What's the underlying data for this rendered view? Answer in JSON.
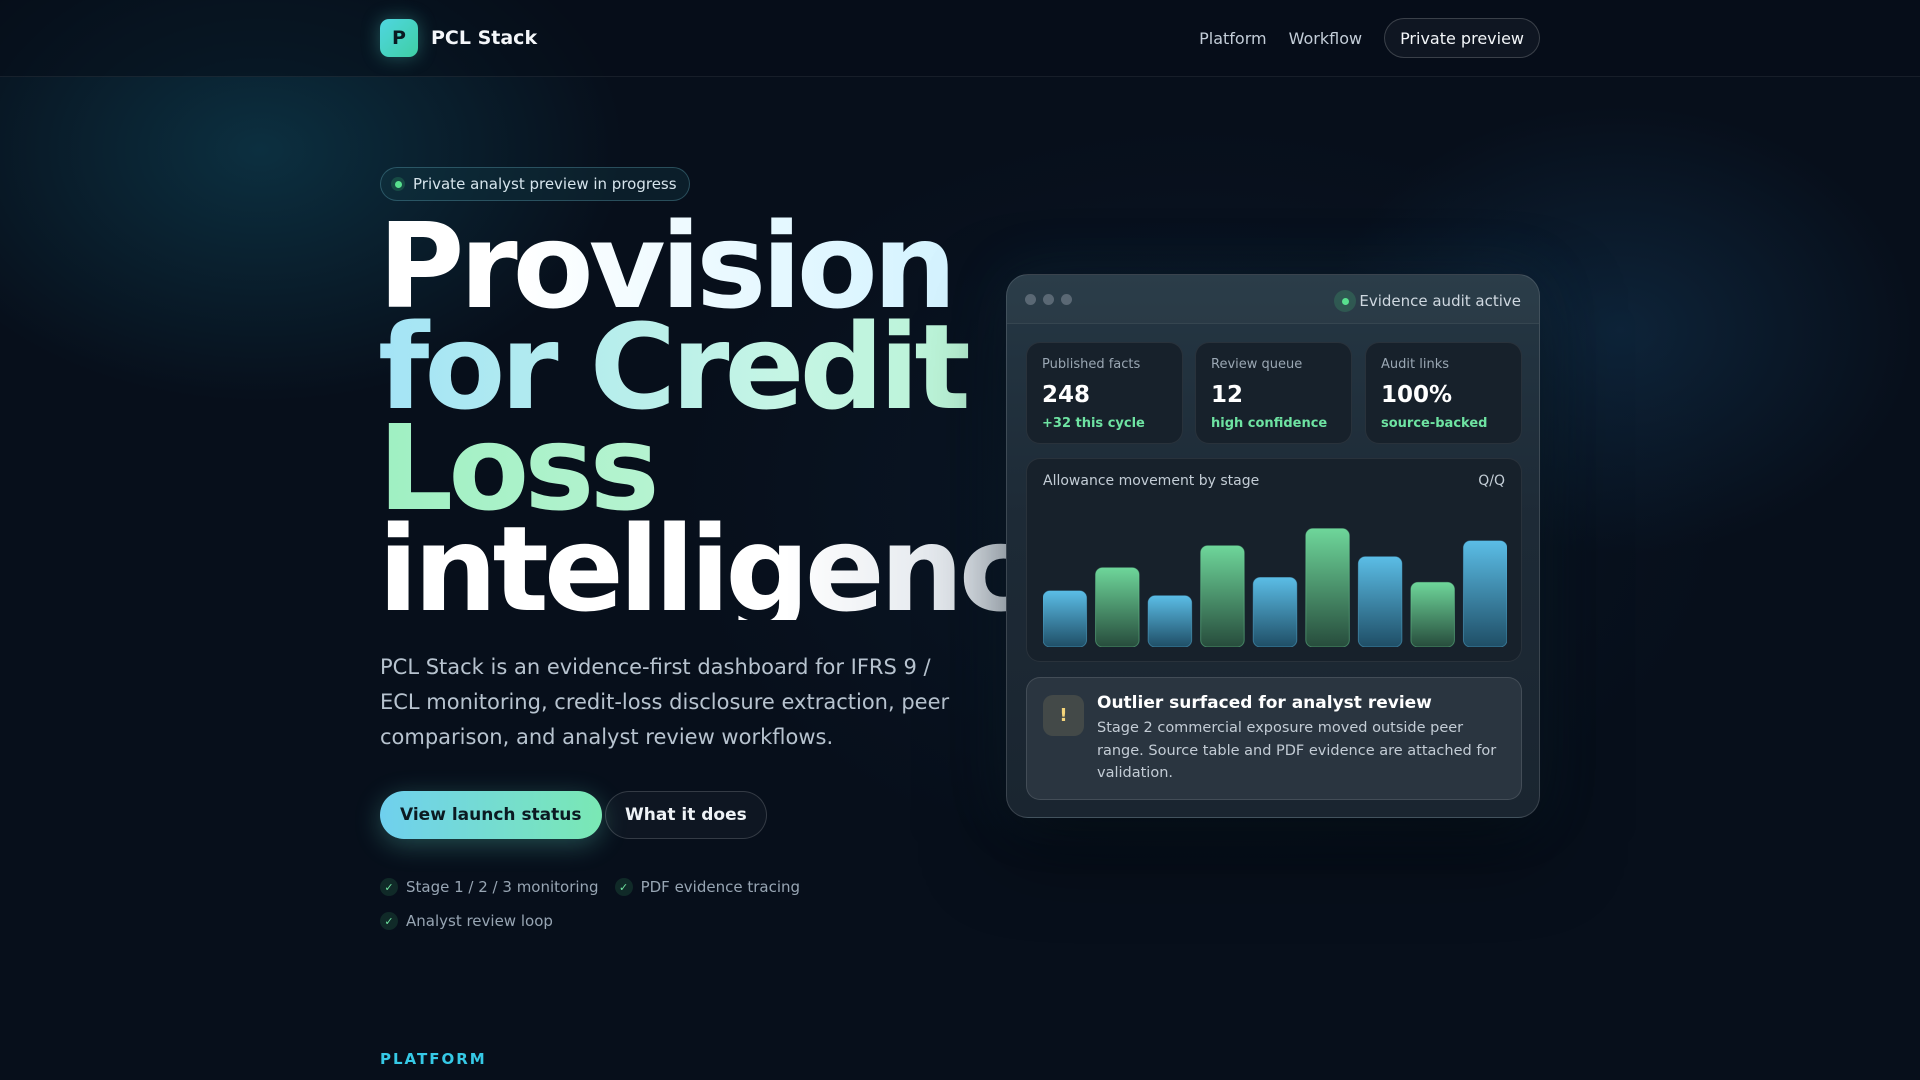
{
  "header": {
    "logo_letter": "P",
    "brand": "PCL Stack",
    "nav": [
      "Platform",
      "Workflow"
    ],
    "cta": "Private preview"
  },
  "hero": {
    "badge": "Private analyst preview in progress",
    "headline": [
      "Provision",
      "for Credit",
      "Loss",
      "intelligence."
    ],
    "lead": "PCL Stack is an evidence-first dashboard for IFRS 9 / ECL monitoring, credit-loss disclosure extraction, peer comparison, and analyst review workflows.",
    "primary_button": "View launch status",
    "secondary_button": "What it does",
    "features": [
      "Stage 1 / 2 / 3 monitoring",
      "PDF evidence tracing",
      "Analyst review loop"
    ],
    "check_glyph": "✓"
  },
  "section_eyebrow": "PLATFORM",
  "dashboard": {
    "status": "Evidence audit active",
    "stats": [
      {
        "label": "Published facts",
        "value": "248",
        "delta": "+32 this cycle"
      },
      {
        "label": "Review queue",
        "value": "12",
        "delta": "high confidence"
      },
      {
        "label": "Audit links",
        "value": "100%",
        "delta": "source-backed"
      }
    ],
    "alert": {
      "icon_glyph": "!",
      "title": "Outlier surfaced for analyst review",
      "body": "Stage 2 commercial exposure moved outside peer range. Source table and PDF evidence are attached for validation."
    }
  },
  "chart_data": {
    "type": "bar",
    "title": "Allowance movement by stage",
    "period": "Q/Q",
    "values": [
      0.46,
      0.65,
      0.42,
      0.83,
      0.57,
      0.97,
      0.74,
      0.53,
      0.87
    ],
    "bar_colors": [
      "blue",
      "green",
      "blue",
      "green",
      "blue",
      "green",
      "blue",
      "green",
      "blue"
    ],
    "ylim": [
      0,
      1
    ],
    "grid": false,
    "colors": {
      "blue": "#5bbde6",
      "green": "#6ed69a"
    }
  },
  "colors": {
    "background": "#070f1b",
    "accent_cyan": "#36c9e6",
    "accent_green": "#6ee3a2",
    "warning": "#f4d47a"
  }
}
